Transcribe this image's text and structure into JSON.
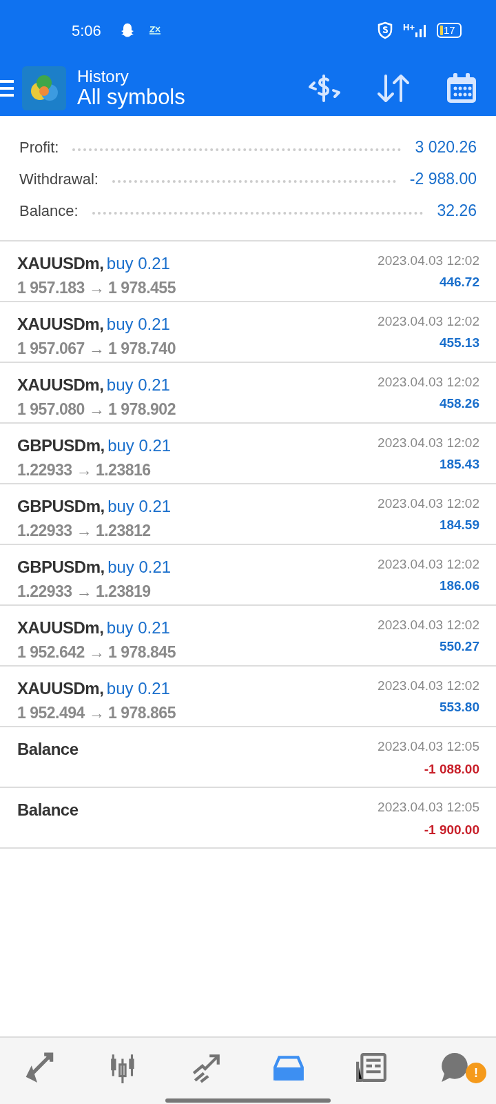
{
  "status_bar": {
    "time": "5:06",
    "network": "H+",
    "battery": "17"
  },
  "header": {
    "title": "History",
    "subtitle": "All symbols"
  },
  "summary": [
    {
      "label": "Profit:",
      "value": "3 020.26"
    },
    {
      "label": "Withdrawal:",
      "value": "-2 988.00"
    },
    {
      "label": "Balance:",
      "value": "32.26"
    }
  ],
  "deals": [
    {
      "kind": "trade",
      "symbol": "XAUUSDm,",
      "order": "buy 0.21",
      "prices": "1 957.183 → 1 978.455",
      "time": "2023.04.03 12:02",
      "amount": "446.72",
      "negative": false
    },
    {
      "kind": "trade",
      "symbol": "XAUUSDm,",
      "order": "buy 0.21",
      "prices": "1 957.067 → 1 978.740",
      "time": "2023.04.03 12:02",
      "amount": "455.13",
      "negative": false
    },
    {
      "kind": "trade",
      "symbol": "XAUUSDm,",
      "order": "buy 0.21",
      "prices": "1 957.080 → 1 978.902",
      "time": "2023.04.03 12:02",
      "amount": "458.26",
      "negative": false
    },
    {
      "kind": "trade",
      "symbol": "GBPUSDm,",
      "order": "buy 0.21",
      "prices": "1.22933 → 1.23816",
      "time": "2023.04.03 12:02",
      "amount": "185.43",
      "negative": false
    },
    {
      "kind": "trade",
      "symbol": "GBPUSDm,",
      "order": "buy 0.21",
      "prices": "1.22933 → 1.23812",
      "time": "2023.04.03 12:02",
      "amount": "184.59",
      "negative": false
    },
    {
      "kind": "trade",
      "symbol": "GBPUSDm,",
      "order": "buy 0.21",
      "prices": "1.22933 → 1.23819",
      "time": "2023.04.03 12:02",
      "amount": "186.06",
      "negative": false
    },
    {
      "kind": "trade",
      "symbol": "XAUUSDm,",
      "order": "buy 0.21",
      "prices": "1 952.642 → 1 978.845",
      "time": "2023.04.03 12:02",
      "amount": "550.27",
      "negative": false
    },
    {
      "kind": "trade",
      "symbol": "XAUUSDm,",
      "order": "buy 0.21",
      "prices": "1 952.494 → 1 978.865",
      "time": "2023.04.03 12:02",
      "amount": "553.80",
      "negative": false
    },
    {
      "kind": "balance",
      "symbol": "Balance",
      "time": "2023.04.03 12:05",
      "amount": "-1 088.00",
      "negative": true
    },
    {
      "kind": "balance",
      "symbol": "Balance",
      "time": "2023.04.03 12:05",
      "amount": "-1 900.00",
      "negative": true
    }
  ],
  "bottom_nav": [
    {
      "selected": false
    },
    {
      "selected": false
    },
    {
      "selected": false
    },
    {
      "selected": true
    },
    {
      "selected": false
    },
    {
      "selected": false,
      "badge": "!"
    }
  ]
}
